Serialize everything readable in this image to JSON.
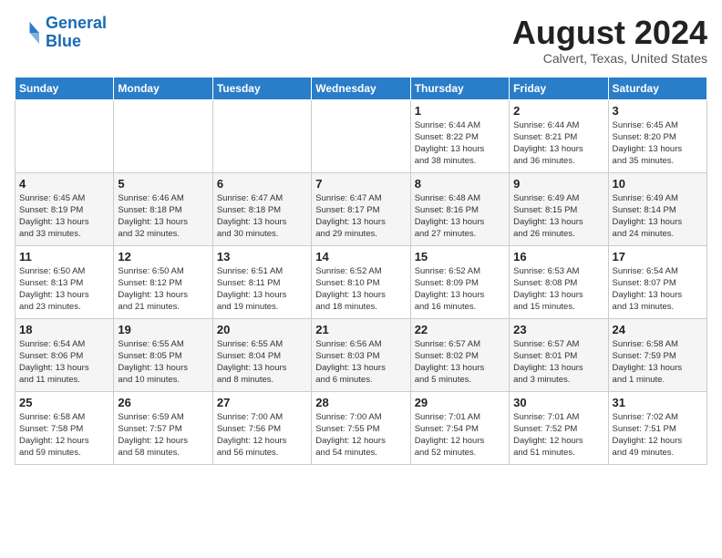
{
  "logo": {
    "line1": "General",
    "line2": "Blue"
  },
  "title": "August 2024",
  "subtitle": "Calvert, Texas, United States",
  "weekdays": [
    "Sunday",
    "Monday",
    "Tuesday",
    "Wednesday",
    "Thursday",
    "Friday",
    "Saturday"
  ],
  "weeks": [
    [
      {
        "day": "",
        "info": ""
      },
      {
        "day": "",
        "info": ""
      },
      {
        "day": "",
        "info": ""
      },
      {
        "day": "",
        "info": ""
      },
      {
        "day": "1",
        "info": "Sunrise: 6:44 AM\nSunset: 8:22 PM\nDaylight: 13 hours\nand 38 minutes."
      },
      {
        "day": "2",
        "info": "Sunrise: 6:44 AM\nSunset: 8:21 PM\nDaylight: 13 hours\nand 36 minutes."
      },
      {
        "day": "3",
        "info": "Sunrise: 6:45 AM\nSunset: 8:20 PM\nDaylight: 13 hours\nand 35 minutes."
      }
    ],
    [
      {
        "day": "4",
        "info": "Sunrise: 6:45 AM\nSunset: 8:19 PM\nDaylight: 13 hours\nand 33 minutes."
      },
      {
        "day": "5",
        "info": "Sunrise: 6:46 AM\nSunset: 8:18 PM\nDaylight: 13 hours\nand 32 minutes."
      },
      {
        "day": "6",
        "info": "Sunrise: 6:47 AM\nSunset: 8:18 PM\nDaylight: 13 hours\nand 30 minutes."
      },
      {
        "day": "7",
        "info": "Sunrise: 6:47 AM\nSunset: 8:17 PM\nDaylight: 13 hours\nand 29 minutes."
      },
      {
        "day": "8",
        "info": "Sunrise: 6:48 AM\nSunset: 8:16 PM\nDaylight: 13 hours\nand 27 minutes."
      },
      {
        "day": "9",
        "info": "Sunrise: 6:49 AM\nSunset: 8:15 PM\nDaylight: 13 hours\nand 26 minutes."
      },
      {
        "day": "10",
        "info": "Sunrise: 6:49 AM\nSunset: 8:14 PM\nDaylight: 13 hours\nand 24 minutes."
      }
    ],
    [
      {
        "day": "11",
        "info": "Sunrise: 6:50 AM\nSunset: 8:13 PM\nDaylight: 13 hours\nand 23 minutes."
      },
      {
        "day": "12",
        "info": "Sunrise: 6:50 AM\nSunset: 8:12 PM\nDaylight: 13 hours\nand 21 minutes."
      },
      {
        "day": "13",
        "info": "Sunrise: 6:51 AM\nSunset: 8:11 PM\nDaylight: 13 hours\nand 19 minutes."
      },
      {
        "day": "14",
        "info": "Sunrise: 6:52 AM\nSunset: 8:10 PM\nDaylight: 13 hours\nand 18 minutes."
      },
      {
        "day": "15",
        "info": "Sunrise: 6:52 AM\nSunset: 8:09 PM\nDaylight: 13 hours\nand 16 minutes."
      },
      {
        "day": "16",
        "info": "Sunrise: 6:53 AM\nSunset: 8:08 PM\nDaylight: 13 hours\nand 15 minutes."
      },
      {
        "day": "17",
        "info": "Sunrise: 6:54 AM\nSunset: 8:07 PM\nDaylight: 13 hours\nand 13 minutes."
      }
    ],
    [
      {
        "day": "18",
        "info": "Sunrise: 6:54 AM\nSunset: 8:06 PM\nDaylight: 13 hours\nand 11 minutes."
      },
      {
        "day": "19",
        "info": "Sunrise: 6:55 AM\nSunset: 8:05 PM\nDaylight: 13 hours\nand 10 minutes."
      },
      {
        "day": "20",
        "info": "Sunrise: 6:55 AM\nSunset: 8:04 PM\nDaylight: 13 hours\nand 8 minutes."
      },
      {
        "day": "21",
        "info": "Sunrise: 6:56 AM\nSunset: 8:03 PM\nDaylight: 13 hours\nand 6 minutes."
      },
      {
        "day": "22",
        "info": "Sunrise: 6:57 AM\nSunset: 8:02 PM\nDaylight: 13 hours\nand 5 minutes."
      },
      {
        "day": "23",
        "info": "Sunrise: 6:57 AM\nSunset: 8:01 PM\nDaylight: 13 hours\nand 3 minutes."
      },
      {
        "day": "24",
        "info": "Sunrise: 6:58 AM\nSunset: 7:59 PM\nDaylight: 13 hours\nand 1 minute."
      }
    ],
    [
      {
        "day": "25",
        "info": "Sunrise: 6:58 AM\nSunset: 7:58 PM\nDaylight: 12 hours\nand 59 minutes."
      },
      {
        "day": "26",
        "info": "Sunrise: 6:59 AM\nSunset: 7:57 PM\nDaylight: 12 hours\nand 58 minutes."
      },
      {
        "day": "27",
        "info": "Sunrise: 7:00 AM\nSunset: 7:56 PM\nDaylight: 12 hours\nand 56 minutes."
      },
      {
        "day": "28",
        "info": "Sunrise: 7:00 AM\nSunset: 7:55 PM\nDaylight: 12 hours\nand 54 minutes."
      },
      {
        "day": "29",
        "info": "Sunrise: 7:01 AM\nSunset: 7:54 PM\nDaylight: 12 hours\nand 52 minutes."
      },
      {
        "day": "30",
        "info": "Sunrise: 7:01 AM\nSunset: 7:52 PM\nDaylight: 12 hours\nand 51 minutes."
      },
      {
        "day": "31",
        "info": "Sunrise: 7:02 AM\nSunset: 7:51 PM\nDaylight: 12 hours\nand 49 minutes."
      }
    ]
  ]
}
